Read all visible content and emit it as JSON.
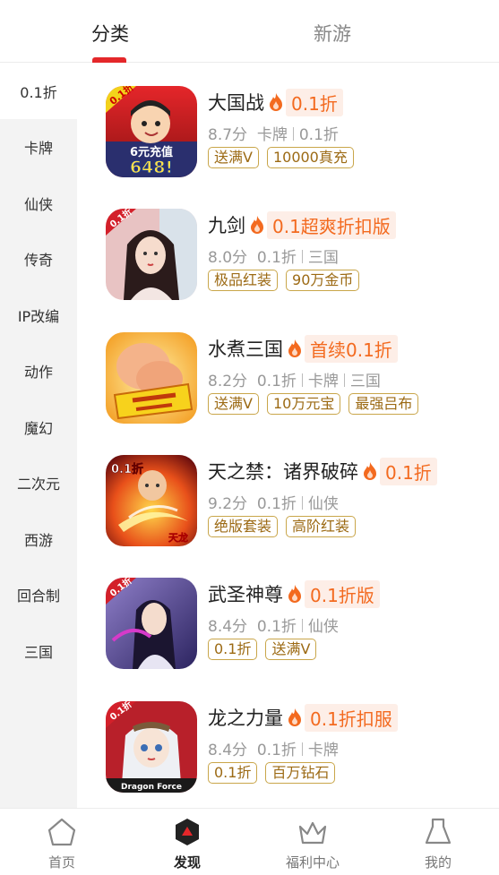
{
  "header": {
    "tabs": [
      {
        "label": "分类",
        "active": true
      },
      {
        "label": "新游",
        "active": false
      }
    ],
    "accent": "#e4272a"
  },
  "sidebar": {
    "items": [
      {
        "label": "0.1折",
        "active": true
      },
      {
        "label": "卡牌"
      },
      {
        "label": "仙侠"
      },
      {
        "label": "传奇"
      },
      {
        "label": "IP改编"
      },
      {
        "label": "动作"
      },
      {
        "label": "魔幻"
      },
      {
        "label": "二次元"
      },
      {
        "label": "西游"
      },
      {
        "label": "回合制"
      },
      {
        "label": "三国"
      }
    ]
  },
  "games": [
    {
      "name": "大国战",
      "badge": "0.1折",
      "score": "8.7分",
      "cats": [
        "卡牌",
        "0.1折"
      ],
      "tags": [
        "送满V",
        "10000真充"
      ],
      "icon": "cartoon-warrior-icon"
    },
    {
      "name": "九剑",
      "badge": "0.1超爽折扣版",
      "score": "8.0分",
      "cats": [
        "0.1折",
        "三国"
      ],
      "tags": [
        "极品红装",
        "90万金币"
      ],
      "icon": "swordswoman-icon"
    },
    {
      "name": "水煮三国",
      "badge": "首续0.1折",
      "score": "8.2分",
      "cats": [
        "0.1折",
        "卡牌",
        "三国"
      ],
      "tags": [
        "送满V",
        "10万元宝",
        "最强吕布"
      ],
      "icon": "fist-icon"
    },
    {
      "name": "天之禁：诸界破碎",
      "badge": "0.1折",
      "score": "9.2分",
      "cats": [
        "0.1折",
        "仙侠"
      ],
      "tags": [
        "绝版套装",
        "高阶红装"
      ],
      "icon": "fire-monk-icon"
    },
    {
      "name": "武圣神尊",
      "badge": "0.1折版",
      "score": "8.4分",
      "cats": [
        "0.1折",
        "仙侠"
      ],
      "tags": [
        "0.1折",
        "送满V"
      ],
      "icon": "xianxia-woman-icon"
    },
    {
      "name": "龙之力量",
      "badge": "0.1折扣服",
      "score": "8.4分",
      "cats": [
        "0.1折",
        "卡牌"
      ],
      "tags": [
        "0.1折",
        "百万钻石"
      ],
      "icon": "anime-girl-icon"
    }
  ],
  "icon_text": {
    "corner": "0.1折",
    "game1_banner": "6元充值",
    "game1_number": "648!",
    "game4_mark": "天龙",
    "game6_caption": "Dragon   Force"
  },
  "colors": {
    "badge": "#f36a1f",
    "tag_border": "#c9a64a",
    "tag_text": "#9c6a14"
  },
  "bottom_nav": [
    {
      "label": "首页",
      "icon": "home-icon",
      "active": false
    },
    {
      "label": "发现",
      "icon": "discover-icon",
      "active": true
    },
    {
      "label": "福利中心",
      "icon": "crown-icon",
      "active": false
    },
    {
      "label": "我的",
      "icon": "profile-icon",
      "active": false
    }
  ]
}
